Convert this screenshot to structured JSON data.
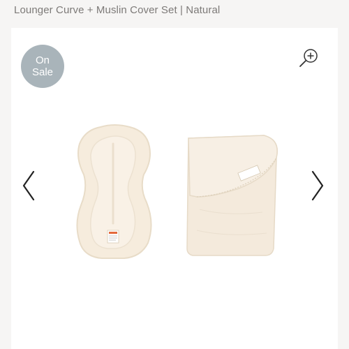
{
  "product": {
    "title": "Lounger Curve + Muslin Cover Set | Natural"
  },
  "badge": {
    "line1": "On",
    "line2": "Sale",
    "color": "#a9b4ba"
  },
  "icons": {
    "zoom": "zoom-in-icon",
    "prev": "chevron-left-icon",
    "next": "chevron-right-icon"
  },
  "colors": {
    "page_bg": "#f6f5f4",
    "gallery_bg": "#ffffff",
    "product_cream": "#f7efe3"
  }
}
